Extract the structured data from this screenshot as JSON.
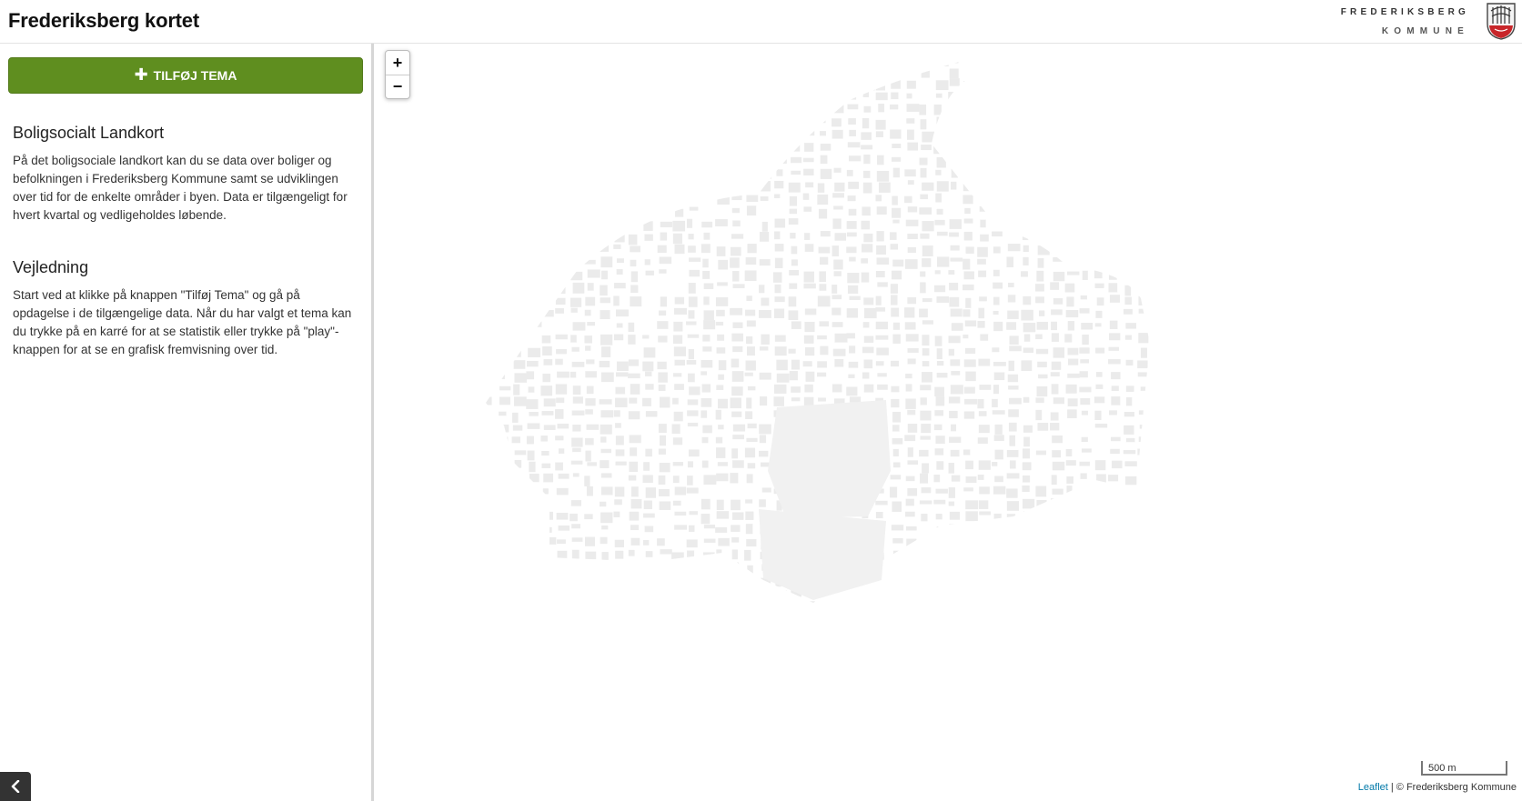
{
  "header": {
    "title": "Frederiksberg kortet",
    "brand_line1": "FREDERIKSBERG",
    "brand_line2": "KOMMUNE"
  },
  "sidebar": {
    "add_theme_label": "TILFØJ TEMA",
    "sections": [
      {
        "heading": "Boligsocialt Landkort",
        "text": "På det boligsociale landkort kan du se data over boliger og befolkningen i Frederiksberg Kommune samt se udviklingen over tid for de enkelte områder i byen. Data er tilgængeligt for hvert kvartal og vedligeholdes løbende."
      },
      {
        "heading": "Vejledning",
        "text": "Start ved at klikke på knappen \"Tilføj Tema\" og gå på opdagelse i de tilgængelige data. Når du har valgt et tema kan du trykke på en karré for at se statistik eller trykke på \"play\"-knappen for at se en grafisk fremvisning over tid."
      }
    ],
    "collapse_icon": "chevron-left-icon"
  },
  "map": {
    "zoom_in": "+",
    "zoom_out": "−",
    "scale_label": "500 m",
    "attribution_link": "Leaflet",
    "attribution_text": " | © Frederiksberg Kommune",
    "building_color": "#ebebeb",
    "park_color": "#f1f1f1"
  }
}
